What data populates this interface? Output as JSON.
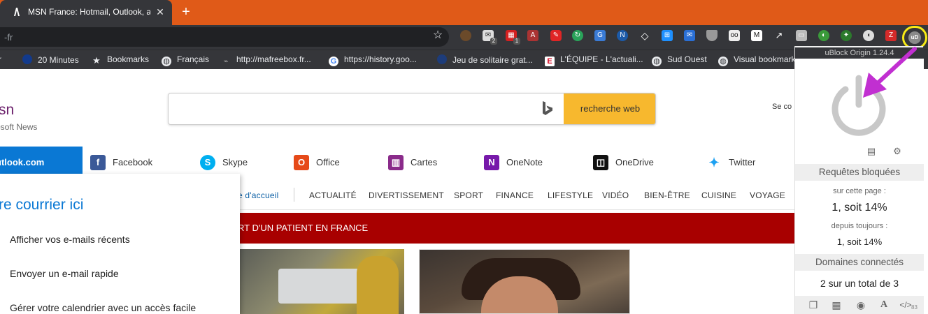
{
  "browser": {
    "tab_title": "MSN France: Hotmail, Outlook, a",
    "tab_close": "✕",
    "new_tab": "+",
    "address_text": "-fr",
    "accent": "#e05a18"
  },
  "bookmarks": [
    {
      "label": "r",
      "icon": "window-icon"
    },
    {
      "label": "20 Minutes",
      "icon": "20minutes-icon"
    },
    {
      "label": "Bookmarks",
      "icon": "star-icon"
    },
    {
      "label": "Français",
      "icon": "globe-icon"
    },
    {
      "label": "http://mafreebox.fr...",
      "icon": "freebox-icon"
    },
    {
      "label": "https://history.goo...",
      "icon": "google-icon"
    },
    {
      "label": "Jeu de solitaire grat...",
      "icon": "solitaire-icon"
    },
    {
      "label": "L'ÉQUIPE - L'actuali...",
      "icon": "lequipe-icon"
    },
    {
      "label": "Sud Ouest",
      "icon": "globe-icon"
    },
    {
      "label": "Visual bookmark",
      "icon": "globe-icon"
    }
  ],
  "extensions": {
    "badge_1": "2",
    "badge_2": "1"
  },
  "msn": {
    "logo": "sn",
    "subtitle": "osoft News",
    "search_placeholder": "",
    "search_button": "recherche web",
    "signin": "Se co"
  },
  "quick_links": [
    {
      "label": "utlook.com"
    },
    {
      "label": "Facebook"
    },
    {
      "label": "Skype"
    },
    {
      "label": "Office"
    },
    {
      "label": "Cartes"
    },
    {
      "label": "OneNote"
    },
    {
      "label": "OneDrive"
    },
    {
      "label": "Twitter"
    }
  ],
  "nav": {
    "home": "e d'accueil",
    "items": [
      "ACTUALITÉ",
      "DIVERTISSEMENT",
      "SPORT",
      "FINANCE",
      "LIFESTYLE",
      "VIDÉO",
      "BIEN-ÊTRE",
      "CUISINE",
      "VOYAGE"
    ]
  },
  "breaking": "RT D'UN PATIENT EN FRANCE",
  "outlook_panel": {
    "heading": "re courrier ici",
    "items": [
      "Afficher vos e-mails récents",
      "Envoyer un e-mail rapide",
      "Gérer votre calendrier avec un accès facile"
    ]
  },
  "ublock": {
    "version": "uBlock Origin 1.24.4",
    "blocked_header": "Requêtes bloquées",
    "this_page_label": "sur cette page :",
    "this_page_value": "1, soit 14%",
    "since_label": "depuis toujours :",
    "since_value": "1, soit 14%",
    "domains_header": "Domaines connectés",
    "domains_value": "2 sur un total de 3",
    "count": "83",
    "icon_label": "uD"
  }
}
